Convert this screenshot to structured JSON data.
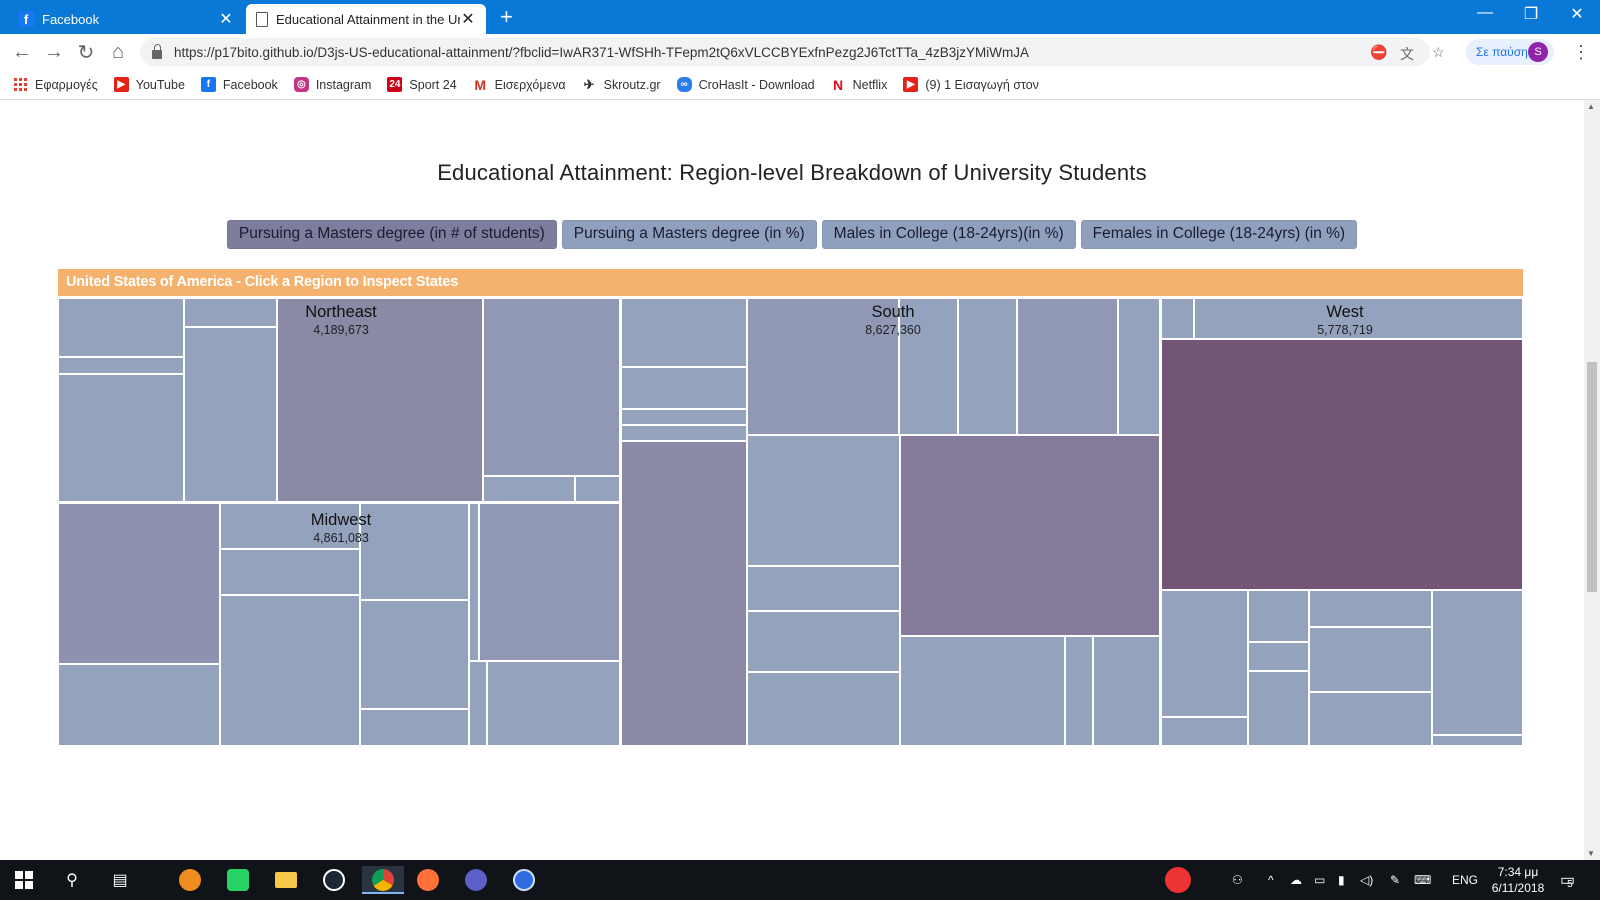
{
  "browser": {
    "tabs": [
      {
        "title": "Facebook",
        "icon": "facebook-icon"
      },
      {
        "title": "Educational Attainment in the Un",
        "icon": "page-icon"
      }
    ],
    "url": "https://p17bito.github.io/D3js-US-educational-attainment/?fbclid=IwAR371-WfSHh-TFepm2tQ6xVLCCBYExfnPezg2J6TctTTa_4zB3jzYMiWmJA",
    "profile_label": "Σε παύση",
    "profile_initial": "S",
    "bookmarks": [
      {
        "label": "Εφαρμογές",
        "icon": "apps-icon"
      },
      {
        "label": "YouTube",
        "icon": "youtube-icon"
      },
      {
        "label": "Facebook",
        "icon": "facebook-icon"
      },
      {
        "label": "Instagram",
        "icon": "instagram-icon"
      },
      {
        "label": "Sport 24",
        "icon": "sport24-icon"
      },
      {
        "label": "Εισερχόμενα",
        "icon": "gmail-icon"
      },
      {
        "label": "Skroutz.gr",
        "icon": "skroutz-icon"
      },
      {
        "label": "CroHasIt - Download",
        "icon": "crohasit-icon"
      },
      {
        "label": "Netflix",
        "icon": "netflix-icon"
      },
      {
        "label": "(9) 1 Εισαγωγή στον",
        "icon": "youtube-icon"
      }
    ]
  },
  "page": {
    "title": "Educational Attainment: Region-level Breakdown of University Students",
    "buttons": [
      {
        "label": "Pursuing a Masters degree (in # of students)",
        "active": true
      },
      {
        "label": "Pursuing a Masters degree (in %)",
        "active": false
      },
      {
        "label": "Males in College (18-24yrs)(in %)",
        "active": false
      },
      {
        "label": "Females in College (18-24yrs) (in %)",
        "active": false
      }
    ],
    "treemap_header": "United States of America - Click a Region to Inspect States",
    "regions": [
      {
        "name": "Northeast",
        "value": "4,189,673"
      },
      {
        "name": "South",
        "value": "8,627,360"
      },
      {
        "name": "West",
        "value": "5,778,719"
      },
      {
        "name": "Midwest",
        "value": "4,861,083"
      }
    ]
  },
  "colors": {
    "tile_light": "#94a2bd",
    "tile_mid": "#8a8aa6",
    "tile_dark": "#735677",
    "header": "#f5b26e",
    "button": "#8fa0bf",
    "button_active": "#7d7d9e"
  },
  "taskbar": {
    "language": "ENG",
    "time": "7:34 μμ",
    "date": "6/11/2018",
    "notification_count": "5"
  }
}
